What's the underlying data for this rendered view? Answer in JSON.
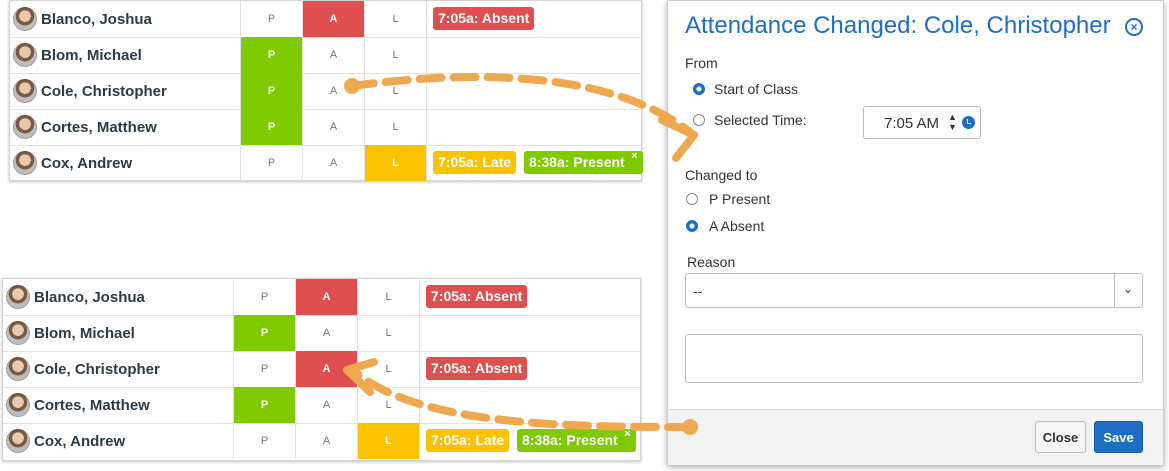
{
  "status_letters": {
    "present": "P",
    "absent": "A",
    "late": "L"
  },
  "roster_top": {
    "rows": [
      {
        "name": "Blanco, Joshua",
        "selected": "A",
        "tags": [
          {
            "text": "7:05a: Absent",
            "color": "red"
          }
        ]
      },
      {
        "name": "Blom, Michael",
        "selected": "P",
        "tags": []
      },
      {
        "name": "Cole, Christopher",
        "selected": "P",
        "tags": []
      },
      {
        "name": "Cortes, Matthew",
        "selected": "P",
        "tags": []
      },
      {
        "name": "Cox, Andrew",
        "selected": "L",
        "tags": [
          {
            "text": "7:05a: Late",
            "color": "yellow"
          },
          {
            "text": "8:38a: Present",
            "color": "green",
            "remove": "×"
          }
        ]
      }
    ]
  },
  "roster_bottom": {
    "rows": [
      {
        "name": "Blanco, Joshua",
        "selected": "A",
        "tags": [
          {
            "text": "7:05a: Absent",
            "color": "red"
          }
        ]
      },
      {
        "name": "Blom, Michael",
        "selected": "P",
        "tags": []
      },
      {
        "name": "Cole, Christopher",
        "selected": "A",
        "tags": [
          {
            "text": "7:05a: Absent",
            "color": "red"
          }
        ]
      },
      {
        "name": "Cortes, Matthew",
        "selected": "P",
        "tags": []
      },
      {
        "name": "Cox, Andrew",
        "selected": "L",
        "tags": [
          {
            "text": "7:05a: Late",
            "color": "yellow"
          },
          {
            "text": "8:38a: Present",
            "color": "green",
            "remove": "×"
          }
        ]
      }
    ]
  },
  "dialog": {
    "title": "Attendance Changed: Cole, Christopher",
    "close_icon": "⊗",
    "from_label": "From",
    "from_start": "Start of Class",
    "from_selected": "Selected Time:",
    "time_value": "7:05 AM",
    "spin_up": "▲",
    "spin_down": "▼",
    "changed_to_label": "Changed to",
    "option_present": "P Present",
    "option_absent": "A Absent",
    "reason_label": "Reason",
    "reason_value": "--",
    "reason_arrow": "⌄",
    "close_button": "Close",
    "save_button": "Save"
  },
  "colors": {
    "accent": "#1f6ec4",
    "present": "#7fcb00",
    "absent": "#e04f4f",
    "late": "#fbc200",
    "arrow": "#f0a850"
  }
}
